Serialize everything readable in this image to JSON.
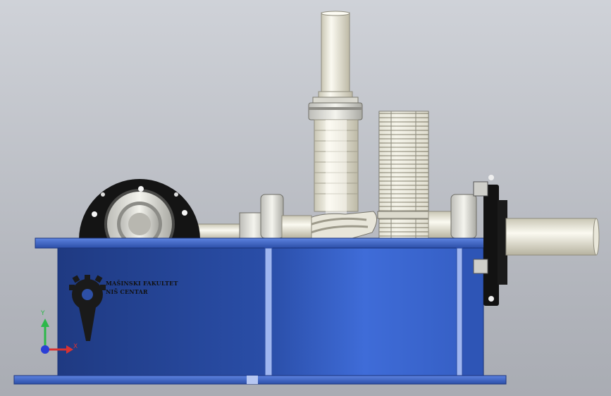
{
  "logo": {
    "line1": "MAŠINSKI FAKULTET",
    "line2": "NIŠ CENTAR",
    "color": "#111111"
  },
  "triad": {
    "y_label": "Y",
    "x_label": "X",
    "y_color": "#2db84a",
    "x_color": "#d83232",
    "z_color": "#2a3fd6"
  },
  "colors": {
    "housing": "#3d6ad6",
    "housing_dark": "#26428f",
    "shaft": "#efeee2",
    "background": "#c3c6cc"
  }
}
